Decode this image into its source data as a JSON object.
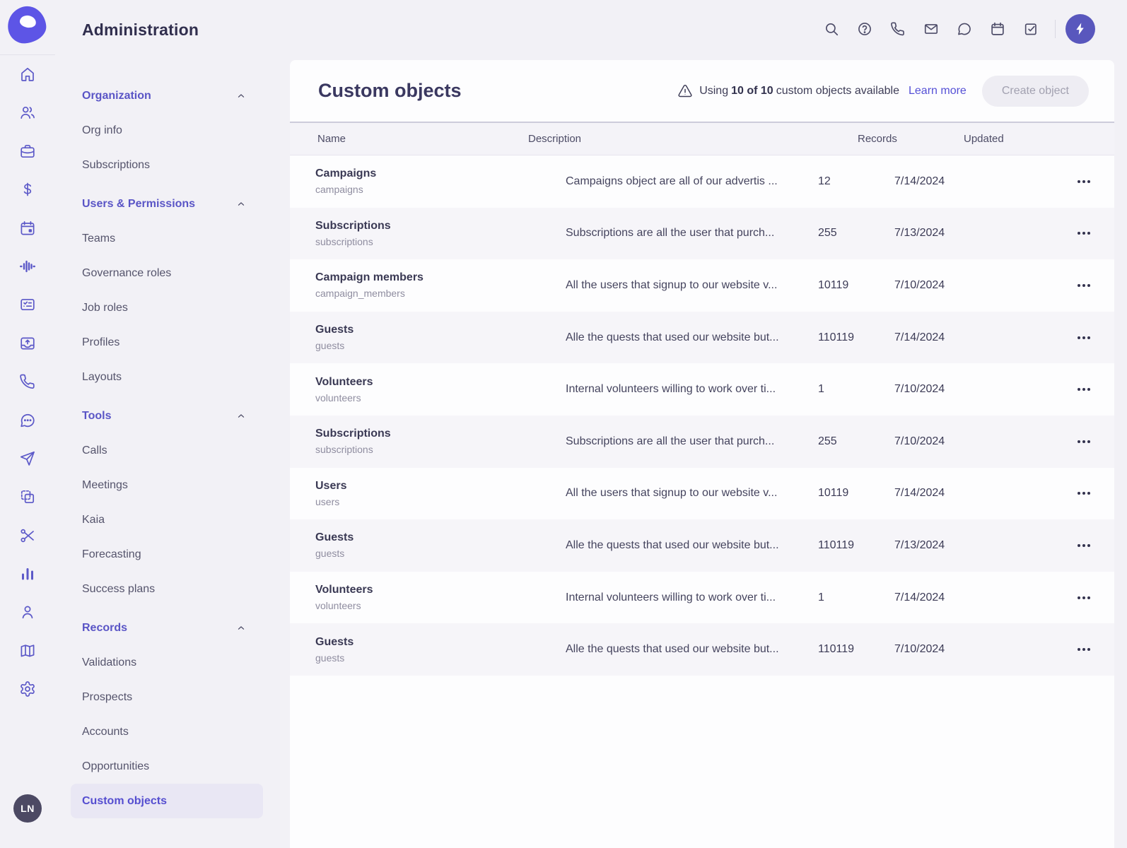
{
  "colors": {
    "accent": "#5c59c8",
    "logo_purple": "#5d55e6",
    "link": "#5550d6",
    "page_bg": "#f2f1f6",
    "panel_bg": "#fdfdfe",
    "row_alt_bg": "#f6f5f9",
    "selected_item_bg": "#e9e7f4",
    "title_text": "#312f4e",
    "body_text": "#3e3d57",
    "muted_text": "#8f8da0",
    "disabled_button_bg": "#eeedf3",
    "disabled_button_text": "#a2a1b0",
    "avatar_bg": "#4c4963",
    "boost_bg": "#5957bd"
  },
  "app": {
    "title": "Administration",
    "logo": "outreach-logo",
    "avatar_initials": "LN"
  },
  "topbar": {
    "icons": [
      "search",
      "help",
      "phone",
      "mail",
      "chat",
      "calendar",
      "tasks"
    ],
    "boost_icon": "lightning"
  },
  "rail": {
    "icons": [
      "home",
      "users",
      "briefcase",
      "dollar",
      "calendar",
      "waveform",
      "report-card",
      "upload-tray",
      "phone",
      "chat-dots",
      "send",
      "copy",
      "scissors",
      "bar-chart",
      "person",
      "map",
      "gear"
    ]
  },
  "sidebar": {
    "sections": [
      {
        "label": "Organization",
        "items": [
          "Org info",
          "Subscriptions"
        ]
      },
      {
        "label": "Users & Permissions",
        "items": [
          "Teams",
          "Governance roles",
          "Job roles",
          "Profiles",
          "Layouts"
        ]
      },
      {
        "label": "Tools",
        "items": [
          "Calls",
          "Meetings",
          "Kaia",
          "Forecasting",
          "Success plans"
        ]
      },
      {
        "label": "Records",
        "items": [
          "Validations",
          "Prospects",
          "Accounts",
          "Opportunities",
          "Custom objects"
        ],
        "selected": "Custom objects"
      }
    ]
  },
  "main": {
    "title": "Custom objects",
    "usage": {
      "prefix": "Using",
      "count": "10 of 10",
      "suffix": "custom objects available",
      "link": "Learn more"
    },
    "create_button": "Create object",
    "table": {
      "columns": [
        "Name",
        "Description",
        "Records",
        "Updated"
      ],
      "rows": [
        {
          "name": "Campaigns",
          "api_name": "campaigns",
          "description": "Campaigns object are all of our advertis ...",
          "records": "12",
          "updated": "7/14/2024"
        },
        {
          "name": "Subscriptions",
          "api_name": "subscriptions",
          "description": "Subscriptions are all the user that purch...",
          "records": "255",
          "updated": "7/13/2024"
        },
        {
          "name": "Campaign members",
          "api_name": "campaign_members",
          "description": "All the users that signup to our website v...",
          "records": "10119",
          "updated": "7/10/2024"
        },
        {
          "name": "Guests",
          "api_name": "guests",
          "description": "Alle the quests that used our website but...",
          "records": "110119",
          "updated": "7/14/2024"
        },
        {
          "name": "Volunteers",
          "api_name": "volunteers",
          "description": "Internal volunteers willing to work over ti...",
          "records": "1",
          "updated": "7/10/2024"
        },
        {
          "name": "Subscriptions",
          "api_name": "subscriptions",
          "description": "Subscriptions are all the user that purch...",
          "records": "255",
          "updated": "7/10/2024"
        },
        {
          "name": "Users",
          "api_name": "users",
          "description": "All the users that signup to our website v...",
          "records": "10119",
          "updated": "7/14/2024"
        },
        {
          "name": "Guests",
          "api_name": "guests",
          "description": "Alle the quests that used our website but...",
          "records": "110119",
          "updated": "7/13/2024"
        },
        {
          "name": "Volunteers",
          "api_name": "volunteers",
          "description": "Internal volunteers willing to work over ti...",
          "records": "1",
          "updated": "7/14/2024"
        },
        {
          "name": "Guests",
          "api_name": "guests",
          "description": "Alle the quests that used our website but...",
          "records": "110119",
          "updated": "7/10/2024"
        }
      ]
    }
  }
}
